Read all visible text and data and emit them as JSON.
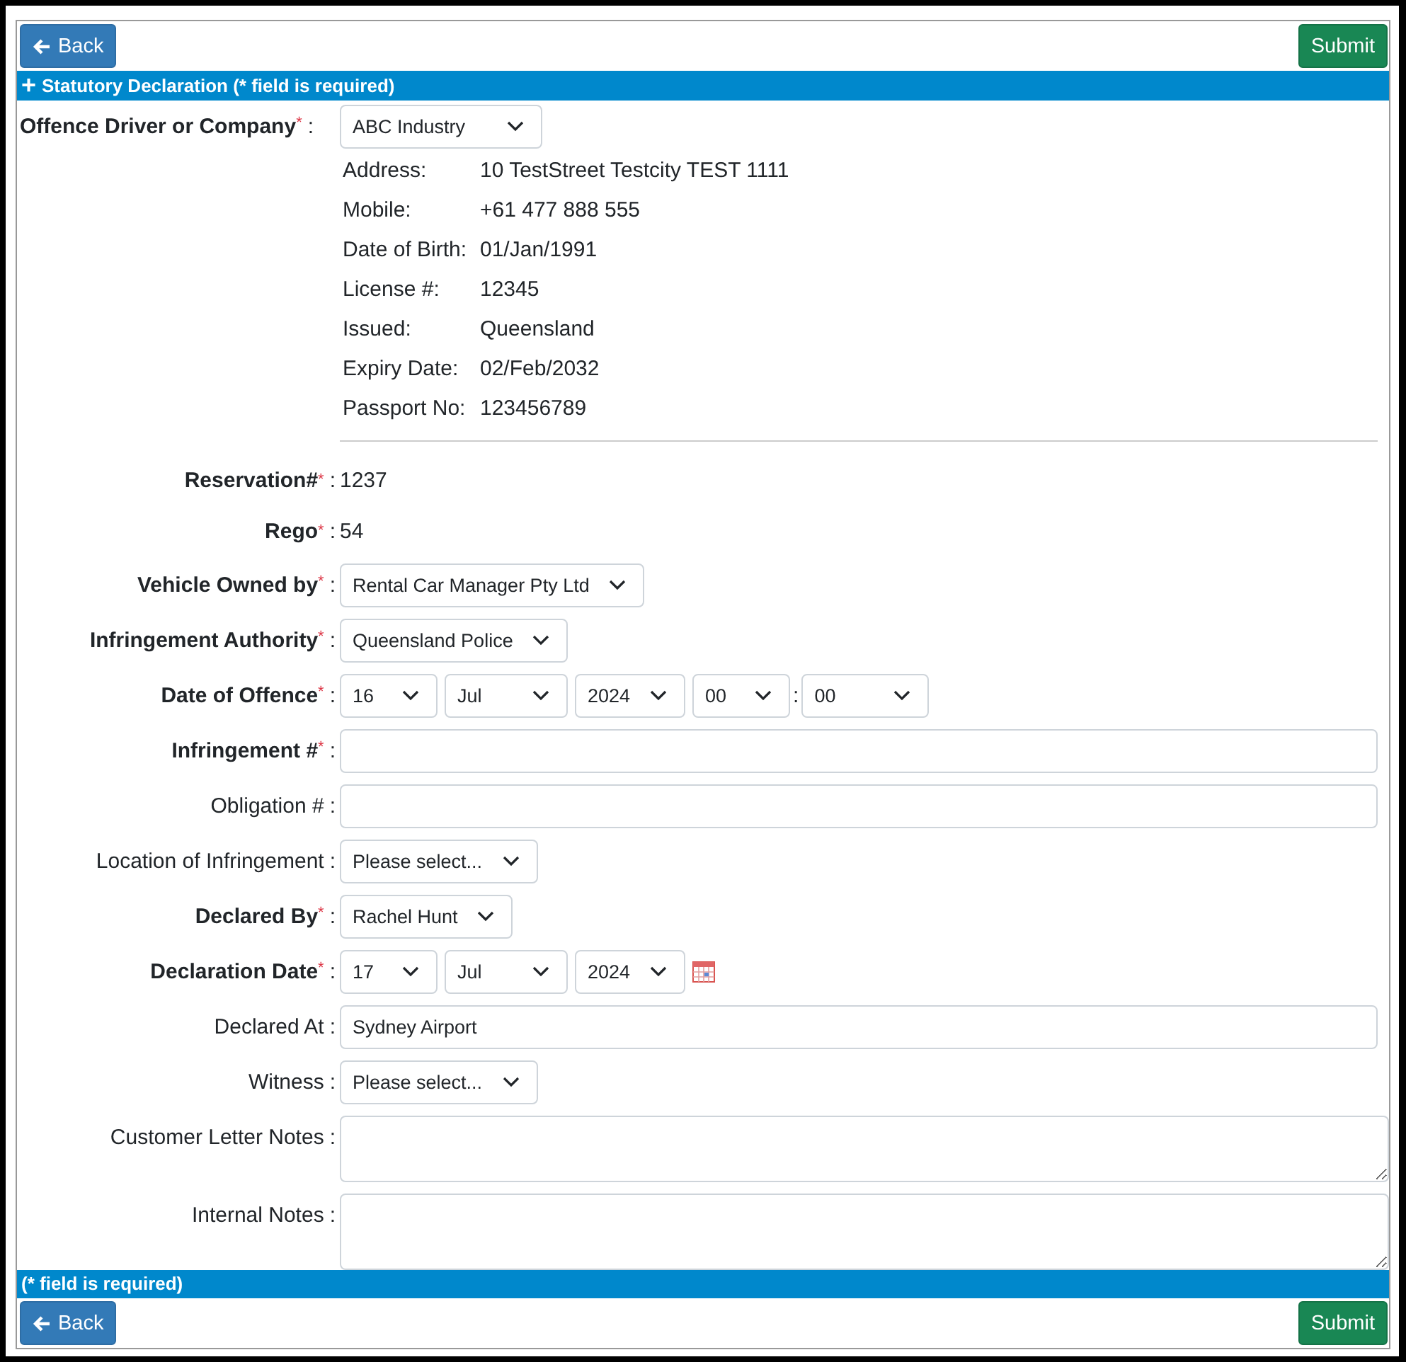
{
  "toolbar_top": {
    "back": "Back",
    "submit": "Submit"
  },
  "header": {
    "icon": "+",
    "title": "Statutory Declaration (* field is required)"
  },
  "driver": {
    "label": "Offence Driver or Company",
    "required": true,
    "mark": "*",
    "colon": ":",
    "value": "ABC Industry",
    "details": [
      {
        "label": "Address:",
        "value": "10 TestStreet Testcity TEST 1111"
      },
      {
        "label": "Mobile:",
        "value": "+61 477 888 555"
      },
      {
        "label": "Date of Birth:",
        "value": "01/Jan/1991"
      },
      {
        "label": "License #:",
        "value": "12345"
      },
      {
        "label": "Issued:",
        "value": "Queensland"
      },
      {
        "label": "Expiry Date:",
        "value": "02/Feb/2032"
      },
      {
        "label": "Passport No:",
        "value": "123456789"
      }
    ]
  },
  "fields": [
    {
      "kind": "value",
      "label": "Reservation#",
      "required": true,
      "mark": "*",
      "colon": ":",
      "value": "1237"
    },
    {
      "kind": "value",
      "label": "Rego",
      "required": true,
      "mark": "*",
      "colon": ":",
      "value": "54"
    },
    {
      "kind": "select",
      "label": "Vehicle Owned by",
      "required": true,
      "mark": "*",
      "colon": ":",
      "value": "Rental Car Manager Pty Ltd"
    },
    {
      "kind": "select",
      "label": "Infringement Authority",
      "required": true,
      "mark": "*",
      "colon": ":",
      "value": "Queensland Police"
    },
    {
      "kind": "date",
      "label": "Date of Offence",
      "required": true,
      "mark": "*",
      "colon": ":",
      "calendar": false,
      "parts": [
        {
          "kind": "select",
          "value": "16"
        },
        {
          "kind": "select",
          "value": "Jul"
        },
        {
          "kind": "select",
          "value": "2024"
        },
        {
          "kind": "select",
          "value": "00"
        },
        {
          "kind": "separator",
          "text": ":"
        },
        {
          "kind": "select",
          "value": "00"
        }
      ]
    },
    {
      "kind": "text",
      "label": "Infringement #",
      "required": true,
      "mark": "*",
      "colon": ":"
    },
    {
      "kind": "text",
      "label": "Obligation #",
      "required": false,
      "colon": ":"
    },
    {
      "kind": "select",
      "label": "Location of Infringement",
      "required": false,
      "colon": ":",
      "value": "Please select..."
    },
    {
      "kind": "select",
      "label": "Declared By",
      "required": true,
      "mark": "*",
      "colon": ":",
      "value": "Rachel Hunt"
    },
    {
      "kind": "date",
      "label": "Declaration Date",
      "required": true,
      "mark": "*",
      "colon": ":",
      "calendar": true,
      "parts": [
        {
          "kind": "select",
          "value": "17"
        },
        {
          "kind": "select",
          "value": "Jul"
        },
        {
          "kind": "select",
          "value": "2024"
        }
      ]
    },
    {
      "kind": "text",
      "label": "Declared At",
      "required": false,
      "colon": ":",
      "value": "Sydney Airport"
    },
    {
      "kind": "select",
      "label": "Witness",
      "required": false,
      "colon": ":",
      "value": "Please select..."
    },
    {
      "kind": "textarea",
      "label": "Customer Letter Notes",
      "required": false,
      "colon": ":"
    },
    {
      "kind": "textarea",
      "label": "Internal Notes",
      "required": false,
      "colon": ":"
    }
  ],
  "footer": {
    "note": "(* field is required)"
  },
  "toolbar_bottom": {
    "back": "Back",
    "submit": "Submit"
  }
}
